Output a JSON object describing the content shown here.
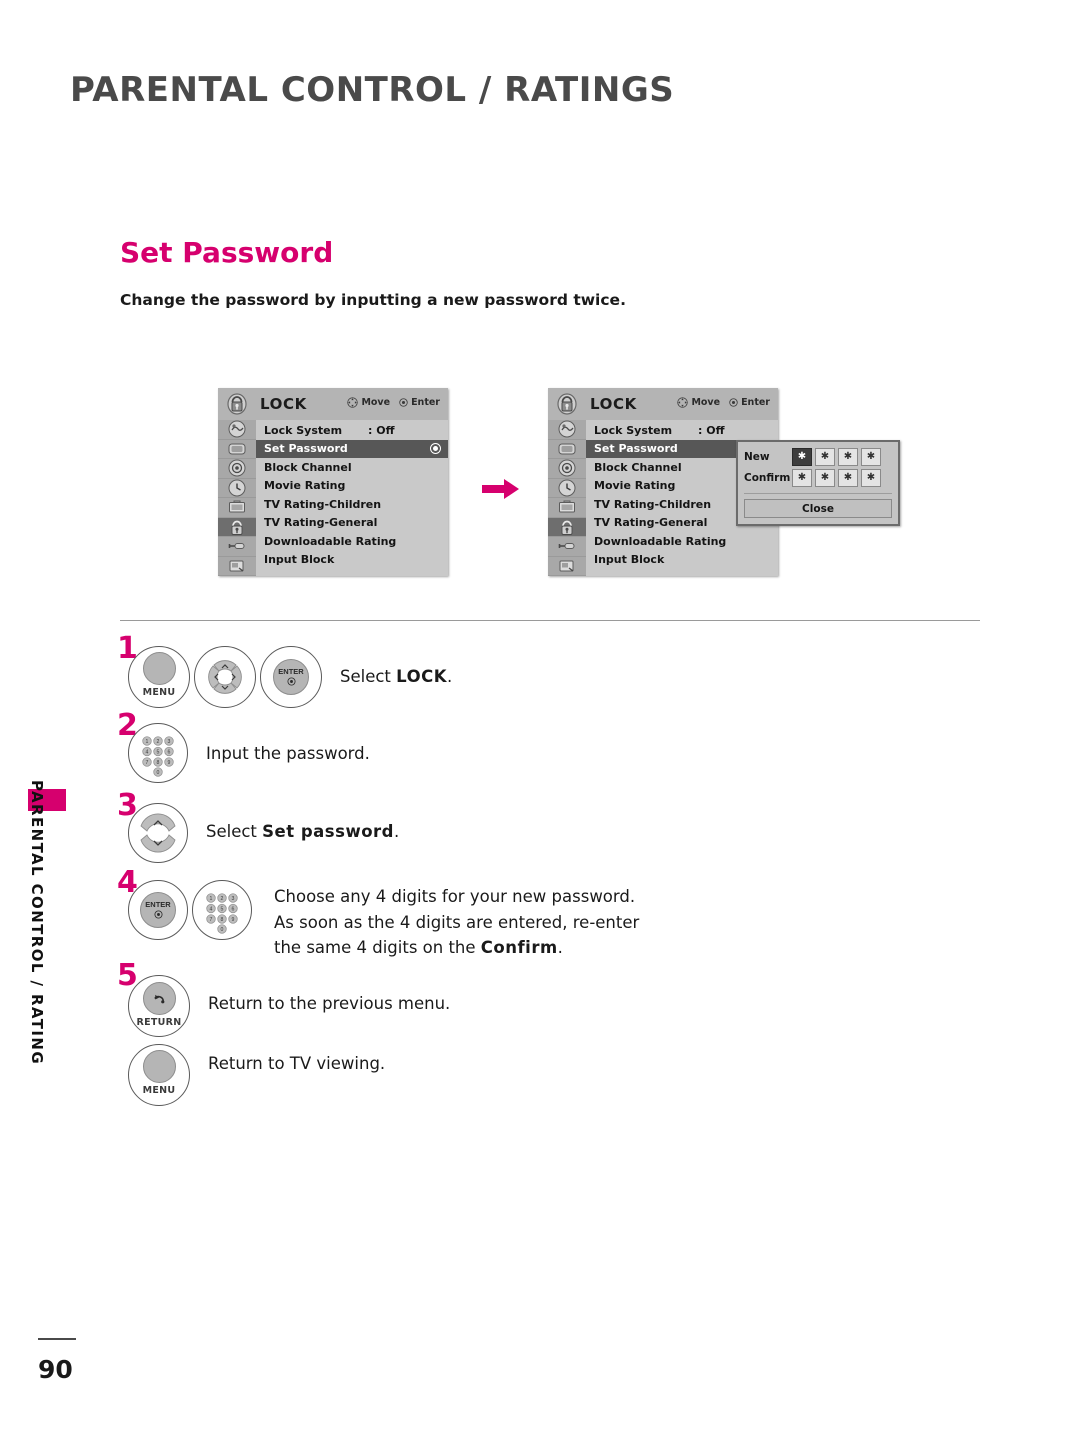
{
  "header": {
    "title": "PARENTAL CONTROL / RATINGS"
  },
  "sidebar": {
    "label": "PARENTAL CONTROL / RATING",
    "tab_color": "#D6006E"
  },
  "section": {
    "title": "Set Password",
    "title_color": "#D6006E",
    "description": "Change the password by inputting a new password twice."
  },
  "osd": {
    "menu_title": "LOCK",
    "hints": [
      {
        "icon": "dpad-icon",
        "label": "Move"
      },
      {
        "icon": "enter-dot-icon",
        "label": "Enter"
      }
    ],
    "icon_column": [
      "picture-icon",
      "audio-tv-icon",
      "setup-icon",
      "time-clock-icon",
      "option-icon",
      "lock-icon",
      "input-icon",
      "usb-icon"
    ],
    "selected_icon_index": 5,
    "items": [
      {
        "label": "Lock System",
        "value": ": Off",
        "selected": false,
        "radio": false
      },
      {
        "label": "Set Password",
        "value": "",
        "selected": true,
        "radio": true
      },
      {
        "label": "Block Channel",
        "value": "",
        "selected": false,
        "radio": false
      },
      {
        "label": "Movie Rating",
        "value": "",
        "selected": false,
        "radio": false
      },
      {
        "label": "TV Rating-Children",
        "value": "",
        "selected": false,
        "radio": false
      },
      {
        "label": "TV Rating-General",
        "value": "",
        "selected": false,
        "radio": false
      },
      {
        "label": "Downloadable Rating",
        "value": "",
        "selected": false,
        "radio": false
      },
      {
        "label": "Input Block",
        "value": "",
        "selected": false,
        "radio": false
      }
    ]
  },
  "password_dialog": {
    "new_label": "New",
    "confirm_label": "Confirm",
    "mask_char": "✱",
    "new_boxes": 4,
    "confirm_boxes": 4,
    "focused_box": 0,
    "close_label": "Close"
  },
  "flow": {
    "arrow": "right-arrow-icon",
    "arrow_color": "#D6006E"
  },
  "steps": [
    {
      "number": "1",
      "buttons": [
        "MENU",
        "DPAD",
        "ENTER"
      ],
      "menu_label": "MENU",
      "enter_label": "ENTER",
      "text_parts": [
        {
          "text": "Select ",
          "bold": false
        },
        {
          "text": "LOCK",
          "bold": true
        },
        {
          "text": ".",
          "bold": false
        }
      ]
    },
    {
      "number": "2",
      "buttons": [
        "KEYPAD"
      ],
      "text_parts": [
        {
          "text": "Input the password.",
          "bold": false
        }
      ]
    },
    {
      "number": "3",
      "buttons": [
        "UPDOWN"
      ],
      "text_parts": [
        {
          "text": "Select ",
          "bold": false
        },
        {
          "text": "Set password",
          "bold": true
        },
        {
          "text": ".",
          "bold": false
        }
      ]
    },
    {
      "number": "4",
      "buttons": [
        "ENTER",
        "KEYPAD"
      ],
      "enter_label": "ENTER",
      "lines": [
        [
          {
            "text": "Choose any 4 digits for your new password.",
            "bold": false
          }
        ],
        [
          {
            "text": "As soon as the 4 digits are entered, re-enter",
            "bold": false
          }
        ],
        [
          {
            "text": "the same 4 digits on the ",
            "bold": false
          },
          {
            "text": "Confirm",
            "bold": true
          },
          {
            "text": ".",
            "bold": false
          }
        ]
      ]
    },
    {
      "number": "5",
      "buttons": [
        "RETURN",
        "MENU"
      ],
      "return_label": "RETURN",
      "menu_label": "MENU",
      "lines": [
        [
          {
            "text": "Return to the previous menu.",
            "bold": false
          }
        ],
        [
          {
            "text": "Return to TV viewing.",
            "bold": false
          }
        ]
      ]
    }
  ],
  "keypad": {
    "digits": [
      "1",
      "2",
      "3",
      "4",
      "5",
      "6",
      "7",
      "8",
      "9",
      "0"
    ]
  },
  "footer": {
    "page_number": "90"
  }
}
